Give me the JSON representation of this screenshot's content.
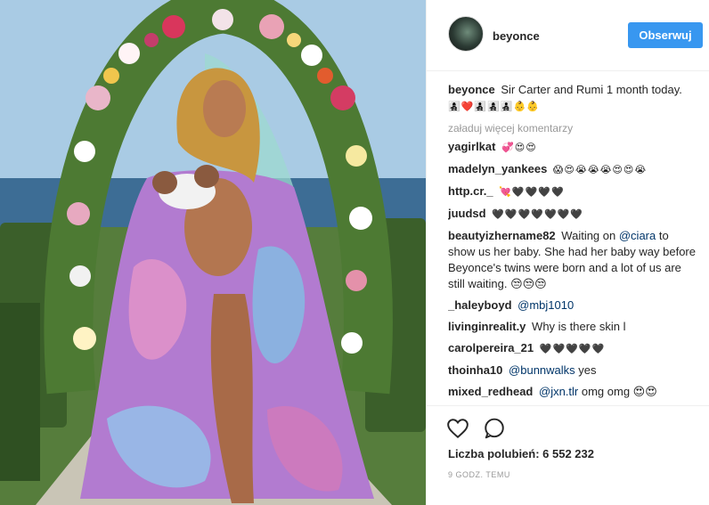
{
  "post": {
    "username": "beyonce",
    "follow_label": "Obserwuj",
    "caption_text": "Sir Carter and Rumi 1 month today.",
    "caption_emoji": "👩‍👧‍👦❤️👨‍👧‍👦👩‍👧‍👦👨‍👧‍👦👶👶"
  },
  "comments": {
    "load_more": "załaduj więcej komentarzy",
    "items": [
      {
        "user": "yagirlkat",
        "emoji": "💞😍😍"
      },
      {
        "user": "madelyn_yankees",
        "emoji": "😱😍😭😭😭😍😍😭"
      },
      {
        "user": "http.cr._",
        "emoji": "💘🖤🖤🖤🖤"
      },
      {
        "user": "juudsd",
        "emoji": "🖤🖤🖤🖤🖤🖤🖤"
      },
      {
        "user": "beautyizhername82",
        "text_before": "Waiting on ",
        "mention": "@ciara",
        "text_after": " to show us her baby. She had her baby way before Beyonce's twins were born and a lot of us are still waiting. 😒😒😒"
      },
      {
        "user": "_haleyboyd",
        "mention": "@mbj1010"
      },
      {
        "user": "livinginrealit.y",
        "text": "Why is there skin l"
      },
      {
        "user": "carolpereira_21",
        "emoji": "🖤🖤🖤🖤🖤"
      },
      {
        "user": "thoinha10",
        "mention": "@bunnwalks",
        "text": " yes"
      },
      {
        "user": "mixed_redhead",
        "mention": "@jxn.tlr",
        "text": " omg omg 😍😍"
      }
    ]
  },
  "actions": {
    "like_icon": "heart-icon",
    "comment_icon": "speech-bubble-icon",
    "likes_text": "Liczba polubień: 6 552 232",
    "timestamp": "9 GODZ. TEMU"
  },
  "colors": {
    "follow_button": "#3897f0",
    "mention": "#003569",
    "muted": "#999999"
  }
}
